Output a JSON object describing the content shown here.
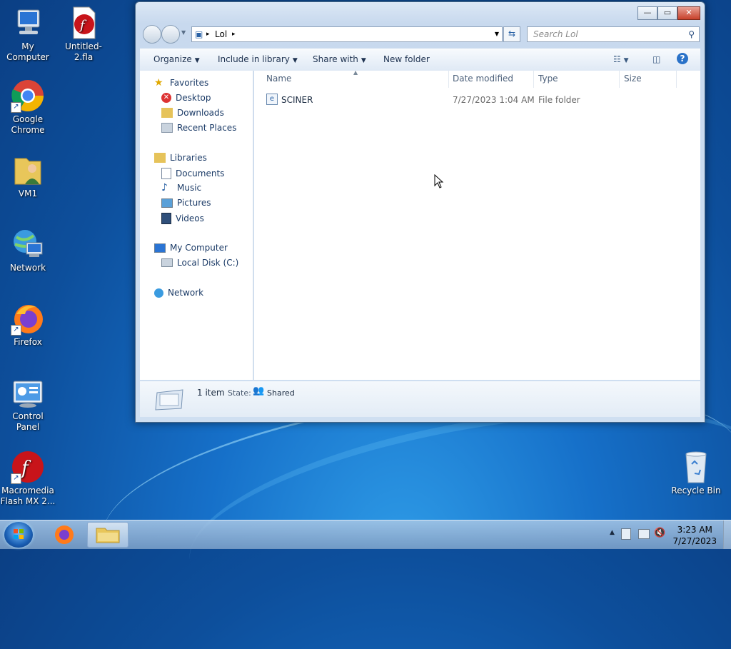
{
  "desktop": {
    "icons": [
      {
        "label": "My Computer",
        "icon": "computer-icon"
      },
      {
        "label": "Untitled-2.fla",
        "icon": "flash-file-icon"
      },
      {
        "label": "Google Chrome",
        "icon": "chrome-icon"
      },
      {
        "label": "VM1",
        "icon": "user-folder-icon"
      },
      {
        "label": "Network",
        "icon": "network-icon"
      },
      {
        "label": "Firefox",
        "icon": "firefox-icon"
      },
      {
        "label": "Control Panel",
        "icon": "control-panel-icon"
      },
      {
        "label": "Macromedia Flash MX 2...",
        "icon": "flash-app-icon"
      },
      {
        "label": "Recycle Bin",
        "icon": "recycle-bin-icon"
      }
    ]
  },
  "window": {
    "address": {
      "segment": "Lol",
      "sep": "▸"
    },
    "search_placeholder": "Search Lol",
    "toolbar": {
      "organize": "Organize",
      "include": "Include in library",
      "share": "Share with",
      "new_folder": "New folder"
    },
    "nav": {
      "favorites": "Favorites",
      "desktop": "Desktop",
      "downloads": "Downloads",
      "recent": "Recent Places",
      "libraries": "Libraries",
      "documents": "Documents",
      "music": "Music",
      "pictures": "Pictures",
      "videos": "Videos",
      "computer": "My Computer",
      "local_disk": "Local Disk (C:)",
      "network": "Network"
    },
    "columns": {
      "name": "Name",
      "date": "Date modified",
      "type": "Type",
      "size": "Size"
    },
    "files": [
      {
        "name": "SCINER",
        "date": "7/27/2023 1:04 AM",
        "type": "File folder",
        "size": ""
      }
    ],
    "status": {
      "count": "1 item",
      "state_label": "State:",
      "state_value": "Shared"
    }
  },
  "taskbar": {
    "time": "3:23 AM",
    "date": "7/27/2023",
    "tray_expand": "▲"
  },
  "colors": {
    "accent": "#1a5fb4",
    "link": "#1a3a66"
  }
}
